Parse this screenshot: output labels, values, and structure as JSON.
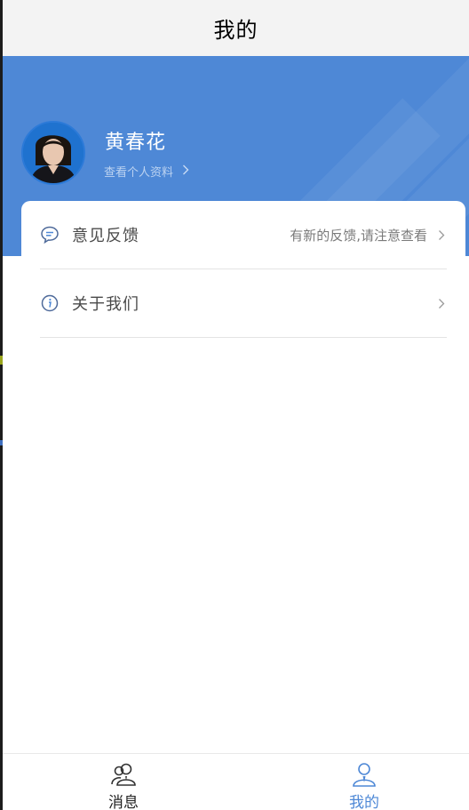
{
  "colors": {
    "brand_blue": "#4e88d6",
    "header_bg": "#f3f3f3",
    "text_dark": "#222222",
    "text_muted": "#7a7a7a"
  },
  "header": {
    "title": "我的"
  },
  "profile": {
    "name": "黄春花",
    "view_profile_label": "查看个人资料",
    "avatar_icon": "user-photo-avatar"
  },
  "menu": {
    "items": [
      {
        "label": "意见反馈",
        "hint": "有新的反馈,请注意查看",
        "icon": "chat-bubble-icon"
      },
      {
        "label": "关于我们",
        "hint": "",
        "icon": "info-circle-icon"
      }
    ]
  },
  "bottom_nav": {
    "tabs": [
      {
        "label": "消息",
        "icon": "contacts-icon",
        "active": false
      },
      {
        "label": "我的",
        "icon": "user-icon",
        "active": true
      }
    ]
  }
}
